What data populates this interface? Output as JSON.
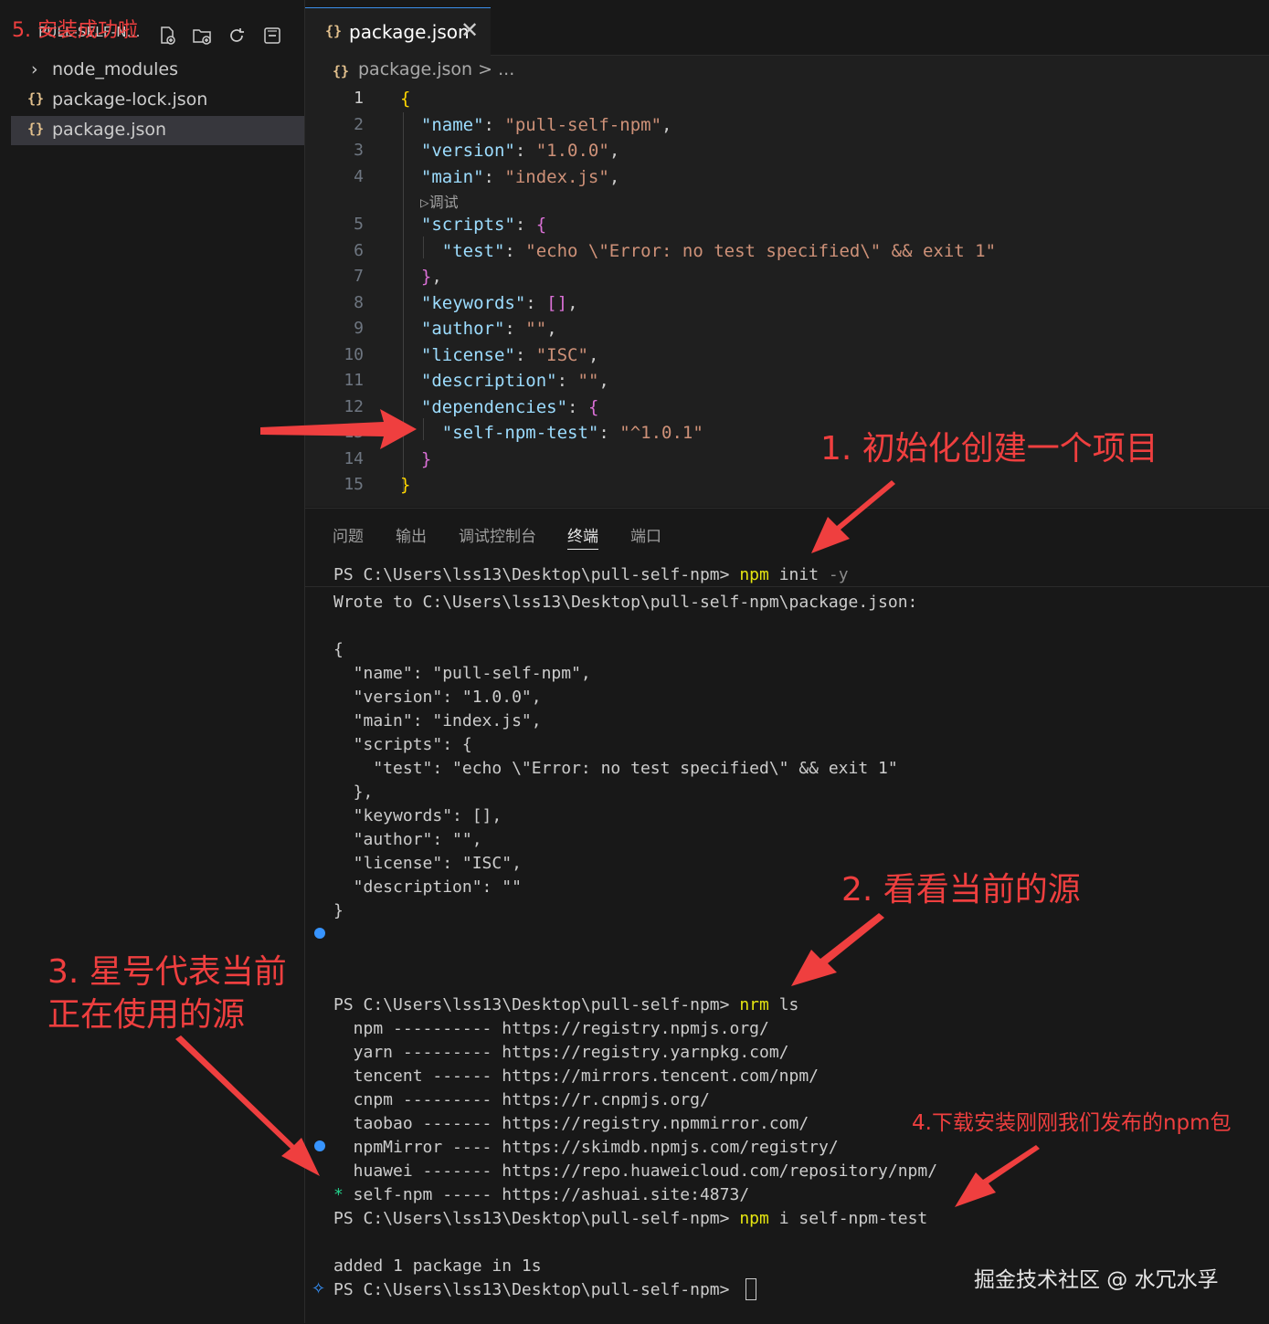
{
  "explorer": {
    "title": "PULL-SELF-N...",
    "header_icons": [
      "new-file-icon",
      "new-folder-icon",
      "refresh-icon",
      "collapse-all-icon"
    ],
    "items": [
      {
        "label": "node_modules",
        "type": "folder",
        "icon": "chevron-right-icon"
      },
      {
        "label": "package-lock.json",
        "type": "json",
        "icon": "{}"
      },
      {
        "label": "package.json",
        "type": "json",
        "icon": "{}",
        "active": true
      }
    ]
  },
  "editor": {
    "tab": {
      "icon": "{}",
      "label": "package.json",
      "close": "✕"
    },
    "breadcrumb": {
      "icon": "{}",
      "file": "package.json",
      "rest": "> ..."
    },
    "codelens": "▷调试",
    "line_numbers": [
      "1",
      "2",
      "3",
      "4",
      "5",
      "6",
      "7",
      "8",
      "9",
      "10",
      "11",
      "12",
      "13",
      "14",
      "15"
    ],
    "lines": {
      "l1": "{",
      "name_k": "\"name\"",
      "name_v": "\"pull-self-npm\"",
      "version_k": "\"version\"",
      "version_v": "\"1.0.0\"",
      "main_k": "\"main\"",
      "main_v": "\"index.js\"",
      "scripts_k": "\"scripts\"",
      "test_k": "\"test\"",
      "test_v": "\"echo \\\"Error: no test specified\\\" && exit 1\"",
      "keywords_k": "\"keywords\"",
      "author_k": "\"author\"",
      "author_v": "\"\"",
      "license_k": "\"license\"",
      "license_v": "\"ISC\"",
      "description_k": "\"description\"",
      "description_v": "\"\"",
      "dependencies_k": "\"dependencies\"",
      "dep_k": "\"self-npm-test\"",
      "dep_v": "\"^1.0.1\""
    }
  },
  "panel": {
    "tabs": [
      "问题",
      "输出",
      "调试控制台",
      "终端",
      "端口"
    ],
    "active_tab": "终端",
    "terminal": {
      "prompt": "PS C:\\Users\\lss13\\Desktop\\pull-self-npm>",
      "cmd1_bin": "npm",
      "cmd1_arg": "init",
      "cmd1_flag": "-y",
      "wrote": "Wrote to C:\\Users\\lss13\\Desktop\\pull-self-npm\\package.json:",
      "json_lines": [
        "{",
        "  \"name\": \"pull-self-npm\",",
        "  \"version\": \"1.0.0\",",
        "  \"main\": \"index.js\",",
        "  \"scripts\": {",
        "    \"test\": \"echo \\\"Error: no test specified\\\" && exit 1\"",
        "  },",
        "  \"keywords\": [],",
        "  \"author\": \"\",",
        "  \"license\": \"ISC\",",
        "  \"description\": \"\"",
        "}"
      ],
      "cmd2_bin": "nrm",
      "cmd2_arg": "ls",
      "registries": [
        "  npm ---------- https://registry.npmjs.org/",
        "  yarn --------- https://registry.yarnpkg.com/",
        "  tencent ------ https://mirrors.tencent.com/npm/",
        "  cnpm --------- https://r.cnpmjs.org/",
        "  taobao ------- https://registry.npmmirror.com/",
        "  npmMirror ---- https://skimdb.npmjs.com/registry/",
        "  huawei ------- https://repo.huaweicloud.com/repository/npm/"
      ],
      "current_star": "*",
      "current_registry": " self-npm ----- https://ashuai.site:4873/",
      "cmd3_bin": "npm",
      "cmd3_arg": "i self-npm-test",
      "added": "added 1 package in 1s"
    }
  },
  "annotations": {
    "note1": "1. 初始化创建一个项目",
    "note2": "2. 看看当前的源",
    "note3_line1": "3. 星号代表当前",
    "note3_line2": "正在使用的源",
    "note4": "4.下载安装刚刚我们发布的npm包",
    "note5": "5. 安装成功啦",
    "color": "#ef3f3f"
  },
  "watermark": "掘金技术社区 @ 水冗水孚",
  "colors": {
    "json_key": "#9cdcfe",
    "json_string": "#ce9178",
    "terminal_command": "#e5e510",
    "accent": "#3794ff"
  }
}
